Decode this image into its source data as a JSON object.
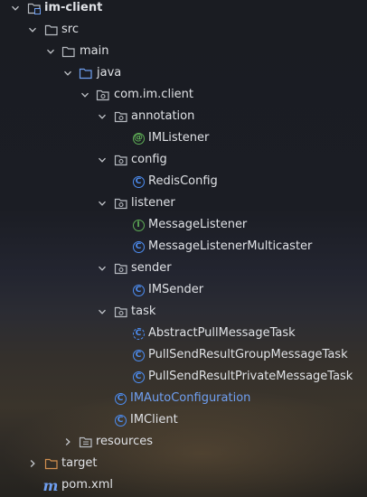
{
  "tree": {
    "root": "im-client",
    "src": "src",
    "main": "main",
    "java": "java",
    "package": "com.im.client",
    "annotation": "annotation",
    "im_listener": "IMListener",
    "config": "config",
    "redis_config": "RedisConfig",
    "listener": "listener",
    "message_listener": "MessageListener",
    "message_listener_multicaster": "MessageListenerMulticaster",
    "sender": "sender",
    "im_sender": "IMSender",
    "task": "task",
    "abstract_pull_task": "AbstractPullMessageTask",
    "pull_group_task": "PullSendResultGroupMessageTask",
    "pull_private_task": "PullSendResultPrivateMessageTask",
    "im_auto_configuration": "IMAutoConfiguration",
    "im_client": "IMClient",
    "resources": "resources",
    "target": "target",
    "pom": "pom.xml"
  },
  "icons": {
    "class": "C",
    "interface": "I",
    "annotation": "@",
    "maven": "m"
  },
  "colors": {
    "text": "#dfe1e5",
    "class_icon": "#4d8ef3",
    "interface_icon": "#5fae57",
    "modified_text": "#6f9ff1",
    "folder_gray": "#b8bcc2",
    "folder_blue": "#6f9ff1",
    "folder_orange": "#d3904f"
  }
}
